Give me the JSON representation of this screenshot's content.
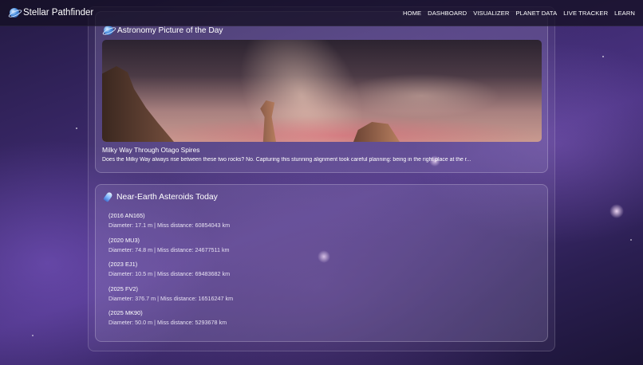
{
  "app": {
    "brand": "Stellar Pathfinder",
    "brand_icon": "planet-icon"
  },
  "nav": {
    "items": [
      "HOME",
      "DASHBOARD",
      "VISUALIZER",
      "PLANET DATA",
      "LIVE TRACKER",
      "LEARN"
    ]
  },
  "apod": {
    "icon": "planet-icon",
    "heading": "Astronomy Picture of the Day",
    "title": "Milky Way Through Otago Spires",
    "description": "Does the Milky Way always rise between these two rocks? No. Capturing this stunning alignment took careful planning: being in the right place at the r..."
  },
  "neo": {
    "icon": "rocket-icon",
    "heading": "Near-Earth Asteroids Today",
    "asteroids": [
      {
        "name": "(2016 AN165)",
        "detail": "Diameter: 17.1 m | Miss distance: 60854043 km"
      },
      {
        "name": "(2020 MU3)",
        "detail": "Diameter: 74.8 m | Miss distance: 24677511 km"
      },
      {
        "name": "(2023 EJ1)",
        "detail": "Diameter: 10.5 m | Miss distance: 69483682 km"
      },
      {
        "name": "(2025 FV2)",
        "detail": "Diameter: 376.7 m | Miss distance: 16516247 km"
      },
      {
        "name": "(2025 MK90)",
        "detail": "Diameter: 50.0 m | Miss distance: 5293678 km"
      }
    ]
  },
  "colors": {
    "accent": "#4a8fe0",
    "navbar_bg": "#14102a"
  }
}
